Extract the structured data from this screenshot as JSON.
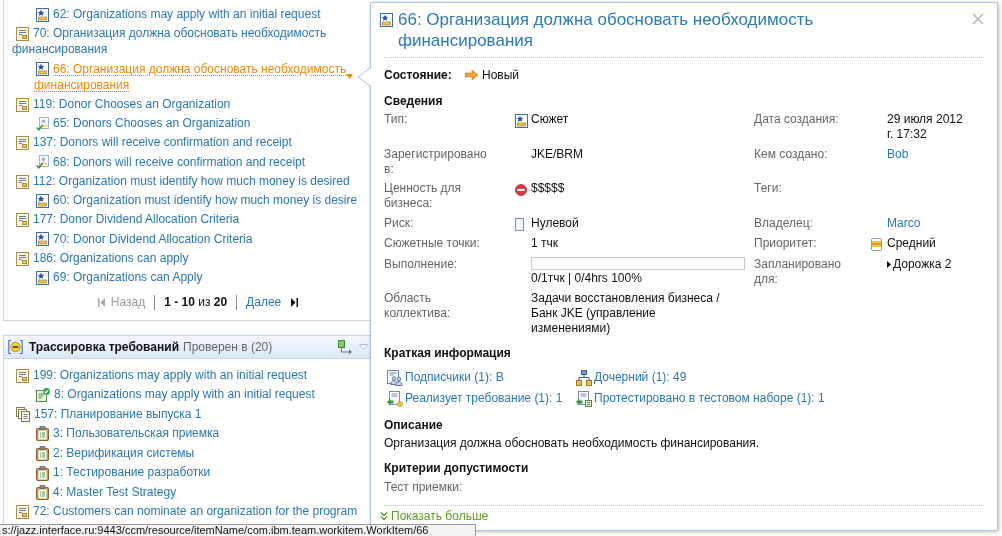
{
  "requirements_panel": {
    "items": [
      {
        "children": [
          {
            "kind": "story",
            "label": "62: Organizations may apply with an initial request",
            "hovered": false
          }
        ]
      },
      {
        "kind": "requirement",
        "label": "70: Организация должна обосновать необходимость финансирования",
        "hovered": false,
        "children": [
          {
            "kind": "story",
            "label": "66: Организация должна обосновать необходимость финансирования",
            "hovered": true
          }
        ]
      },
      {
        "kind": "requirement",
        "label": "119: Donor Chooses an Organization",
        "hovered": false,
        "children": [
          {
            "kind": "story-done",
            "label": "65: Donors Chooses an Organization",
            "hovered": false
          }
        ]
      },
      {
        "kind": "requirement",
        "label": "137: Donors will receive confirmation and receipt",
        "hovered": false,
        "children": [
          {
            "kind": "story-done",
            "label": "68: Donors will receive confirmation and receipt",
            "hovered": false
          }
        ]
      },
      {
        "kind": "requirement",
        "label": "112: Organization must identify how much money is desired",
        "hovered": false,
        "children": [
          {
            "kind": "story",
            "label": "60: Organization must identify how much money is desire",
            "hovered": false
          }
        ]
      },
      {
        "kind": "requirement",
        "label": "177: Donor Dividend Allocation Criteria",
        "hovered": false,
        "children": [
          {
            "kind": "story",
            "label": "70: Donor Dividend Allocation Criteria",
            "hovered": false
          }
        ]
      },
      {
        "kind": "requirement",
        "label": "186: Organizations can apply",
        "hovered": false,
        "children": [
          {
            "kind": "story",
            "label": "69: Organizations can Apply",
            "hovered": false
          }
        ]
      }
    ],
    "pagination": {
      "previous": {
        "label": "Назад",
        "disabled": true
      },
      "range": "**1 - 10** из **20**",
      "next": {
        "label": "Далее",
        "disabled": false
      }
    }
  },
  "traceability_panel": {
    "title": "Трассировка требований",
    "subtitle": "Проверен в (20)",
    "items": [
      {
        "kind": "requirement",
        "label": "199: Organizations may apply with an initial request",
        "hovered": false,
        "children": [
          {
            "kind": "test-case",
            "label": "8: Organizations may apply with an initial request",
            "hovered": false
          }
        ]
      },
      {
        "kind": "test-plan",
        "label": "157: Планирование выпуска 1",
        "hovered": false,
        "children": [
          {
            "kind": "test-suite",
            "label": "3: Пользовательская приемка",
            "hovered": false
          },
          {
            "kind": "test-suite",
            "label": "2: Верификация системы",
            "hovered": false
          },
          {
            "kind": "test-suite",
            "label": "1: Тестирование разработки",
            "hovered": false
          },
          {
            "kind": "test-suite",
            "label": "4: Master Test Strategy",
            "hovered": false
          }
        ]
      },
      {
        "kind": "requirement",
        "label": "72: Customers can nominate an organization for the program",
        "hovered": false
      }
    ]
  },
  "hover_card": {
    "kind": "story",
    "title": "66: Организация должна обосновать необходимость финансирования",
    "state": {
      "label": "Состояние:",
      "value": "Новый"
    },
    "details": {
      "heading": "Сведения",
      "rows": [
        [
          {
            "label": "Тип:",
            "kind": "work-item-type",
            "value": "Сюжет"
          },
          {
            "label": "Дата создания:",
            "kind": "text",
            "value": "29 июля 2012 г. 17:32"
          }
        ],
        [
          {
            "label": "Зарегистрировано в:",
            "kind": "text",
            "value": "JKE/BRM"
          },
          {
            "label": "Кем создано:",
            "kind": "link",
            "value": "Bob"
          }
        ],
        [
          {
            "label": "Ценность для бизнеса:",
            "kind": "business-value",
            "value": "$$$$$"
          },
          {
            "label": "Теги:",
            "kind": "text"
          }
        ],
        [
          {
            "label": "Риск:",
            "kind": "risk",
            "value": "Нулевой"
          },
          {
            "label": "Владелец:",
            "kind": "link",
            "value": "Marco"
          }
        ],
        [
          {
            "label": "Сюжетные точки:",
            "kind": "text",
            "value": "1 тчк"
          },
          {
            "label": "Приоритет:",
            "kind": "priority",
            "value": "Средний"
          }
        ],
        [
          {
            "label": "Выполнение:",
            "kind": "progress",
            "level": 0,
            "value": "0/1тчк | 0/4hrs 100%"
          },
          {
            "label": "Запланировано для:",
            "kind": "iteration",
            "value": "Дорожка 2"
          }
        ],
        [
          {
            "label": "Область коллектива:",
            "kind": "text",
            "value": "Задачи восстановления бизнеса / Банк JKE (управление изменениями)"
          }
        ]
      ]
    },
    "quick_info": {
      "heading": "Краткая информация",
      "links": [
        {
          "kind": "subscribers",
          "label": "Подписчики (1): B"
        },
        {
          "kind": "children",
          "label": "Дочерний (1): 49"
        },
        {
          "kind": "implements",
          "label": "Реализует требование (1): 1"
        },
        {
          "kind": "tested-by",
          "label": "Протестировано в тестовом наборе (1): 1"
        }
      ]
    },
    "description": {
      "heading": "Описание",
      "text": "Организация должна обосновать необходимость финансирования."
    },
    "acceptance": {
      "heading": "Критерии допустимости",
      "fields": [
        {
          "label": "Тест приемки:"
        }
      ]
    },
    "show_more": "Показать больше"
  },
  "status_bar": {
    "url": "s://jazz.interface.ru:9443/ccm/resource/itemName/com.ibm.team.workitem.WorkItem/66"
  }
}
